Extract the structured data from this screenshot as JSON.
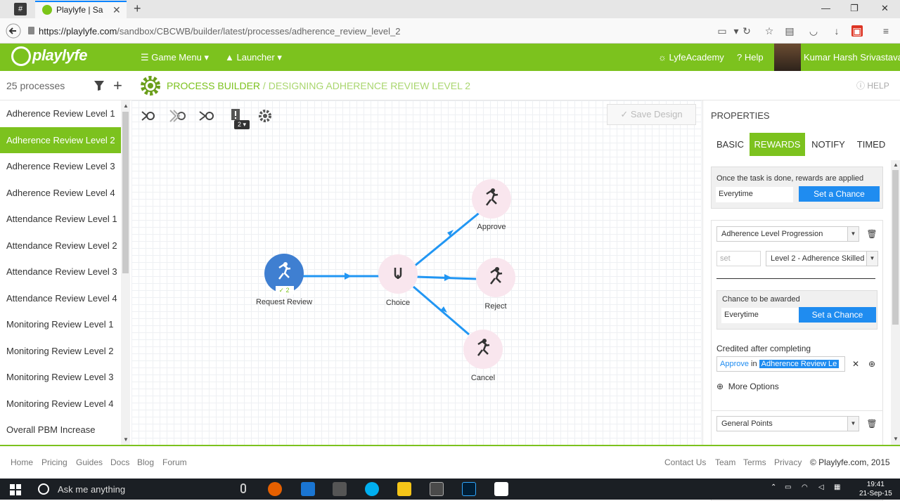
{
  "browser": {
    "pinned_tab": "#",
    "active_tab_title": "Playlyfe | Sa",
    "url_domain": "https://playlyfe.com",
    "url_path": "/sandbox/CBCWB/builder/latest/processes/adherence_review_level_2",
    "new_tab": "+"
  },
  "header": {
    "logo": "playlyfe",
    "game_menu": "Game Menu",
    "launcher": "Launcher",
    "lyfe_academy": "LyfeAcademy",
    "help": "Help",
    "user_name": "Kumar Harsh Srivastava"
  },
  "subheader": {
    "process_count": "25 processes",
    "breadcrumb_root": "PROCESS BUILDER",
    "breadcrumb_current": "DESIGNING ADHERENCE REVIEW LEVEL 2",
    "help": "HELP"
  },
  "sidebar": {
    "items": [
      {
        "label": "Adherence Review Level 1",
        "active": false
      },
      {
        "label": "Adherence Review Level 2",
        "active": true
      },
      {
        "label": "Adherence Review Level 3",
        "active": false
      },
      {
        "label": "Adherence Review Level 4",
        "active": false
      },
      {
        "label": "Attendance Review Level 1",
        "active": false
      },
      {
        "label": "Attendance Review Level 2",
        "active": false
      },
      {
        "label": "Attendance Review Level 3",
        "active": false
      },
      {
        "label": "Attendance Review Level 4",
        "active": false
      },
      {
        "label": "Monitoring Review Level 1",
        "active": false
      },
      {
        "label": "Monitoring Review Level 2",
        "active": false
      },
      {
        "label": "Monitoring Review Level 3",
        "active": false
      },
      {
        "label": "Monitoring Review Level 4",
        "active": false
      },
      {
        "label": "Overall PBM Increase",
        "active": false
      }
    ]
  },
  "canvas": {
    "save_design": "Save Design",
    "badge_count": "2",
    "nodes": {
      "request_review": "Request Review",
      "request_review_check": "2",
      "choice": "Choice",
      "approve": "Approve",
      "reject": "Reject",
      "cancel": "Cancel"
    }
  },
  "properties": {
    "title": "PROPERTIES",
    "tabs": [
      "BASIC",
      "REWARDS",
      "NOTIFY",
      "TIMED"
    ],
    "active_tab": "REWARDS",
    "rewards_applied_label": "Once the task is done, rewards are applied",
    "rewards_applied_value": "Everytime",
    "set_chance": "Set a Chance",
    "metric_1": "Adherence Level Progression",
    "set_placeholder": "set",
    "level_value": "Level 2 - Adherence Skilled",
    "chance_label": "Chance to be awarded",
    "chance_value": "Everytime",
    "set_chance_2": "Set a Chance",
    "credited_label": "Credited after completing",
    "credited_task": "Approve",
    "credited_in": "in",
    "credited_process": "Adherence Review Le",
    "more_options": "More Options",
    "metric_2": "General Points"
  },
  "footer": {
    "links_left": [
      "Home",
      "Pricing",
      "Guides",
      "Docs",
      "Blog",
      "Forum"
    ],
    "links_right": [
      "Contact Us",
      "Team",
      "Terms",
      "Privacy"
    ],
    "copyright": "© Playlyfe.com, 2015"
  },
  "taskbar": {
    "search_placeholder": "Ask me anything",
    "time": "19:41",
    "date": "21-Sep-15"
  },
  "colors": {
    "brand_green": "#7cc21e",
    "node_blue": "#3f7fd1",
    "edge_blue": "#2196f3",
    "button_blue": "#1f8cf0"
  }
}
